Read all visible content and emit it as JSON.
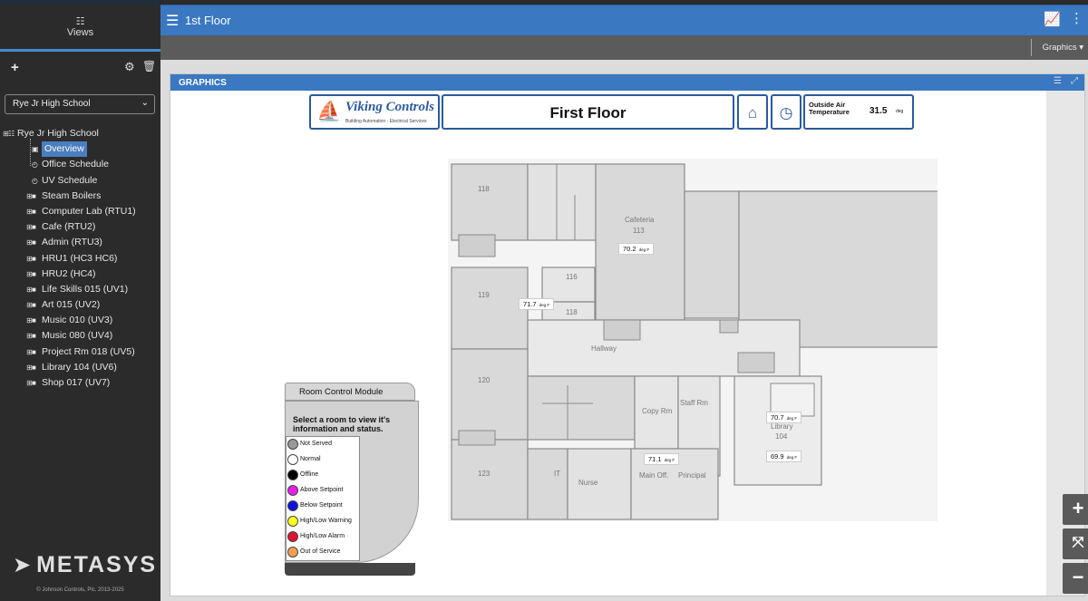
{
  "sidebar": {
    "views_label": "Views",
    "site_select": "Rye Jr High School",
    "tree": [
      {
        "label": "Rye Jr High School",
        "kind": "root"
      },
      {
        "label": "Overview",
        "kind": "child",
        "icon": "graphic-icon",
        "selected": true
      },
      {
        "label": "Office Schedule",
        "kind": "child",
        "icon": "clock-icon"
      },
      {
        "label": "UV Schedule",
        "kind": "child",
        "icon": "clock-icon"
      },
      {
        "label": "Steam Boilers",
        "kind": "folder"
      },
      {
        "label": "Computer Lab (RTU1)",
        "kind": "folder"
      },
      {
        "label": "Cafe (RTU2)",
        "kind": "folder"
      },
      {
        "label": "Admin (RTU3)",
        "kind": "folder"
      },
      {
        "label": "HRU1 (HC3 HC6)",
        "kind": "folder"
      },
      {
        "label": "HRU2 (HC4)",
        "kind": "folder"
      },
      {
        "label": "Life Skills 015 (UV1)",
        "kind": "folder"
      },
      {
        "label": "Art 015 (UV2)",
        "kind": "folder"
      },
      {
        "label": "Music 010 (UV3)",
        "kind": "folder"
      },
      {
        "label": "Music 080 (UV4)",
        "kind": "folder"
      },
      {
        "label": "Project Rm 018 (UV5)",
        "kind": "folder"
      },
      {
        "label": "Library 104 (UV6)",
        "kind": "folder"
      },
      {
        "label": "Shop 017 (UV7)",
        "kind": "folder"
      }
    ],
    "brand": "METASYS",
    "copyright": "© Johnson Controls, Plc. 2013-2025"
  },
  "header": {
    "title": "1st Floor",
    "menu_label": "Graphics ▾"
  },
  "panel": {
    "title": "GRAPHICS"
  },
  "graphic": {
    "logo_name": "Viking Controls",
    "logo_sub": "Building Automation · Electrical Services",
    "floor_title": "First Floor",
    "oat_label_1": "Outside Air",
    "oat_label_2": "Temperature",
    "oat_value": "31.5",
    "oat_unit": "deg"
  },
  "rooms": {
    "r118a": "118",
    "cafeteria": "Cafeteria",
    "cafeteria_num": "113",
    "r116": "116",
    "r119": "119",
    "r118b": "118",
    "hallway": "Hallway",
    "r120": "120",
    "copy": "Copy Rm",
    "staff": "Staff Rm",
    "library": "Library",
    "library_num": "104",
    "r123": "123",
    "it": "IT",
    "nurse": "Nurse",
    "main_off": "Main Off.",
    "principal": "Principal"
  },
  "temps": {
    "cafeteria": "70.2",
    "r119": "71.7",
    "main_off": "71.1",
    "library_a": "70.7",
    "library_b": "69.9",
    "unit": "deg F"
  },
  "rcm": {
    "title": "Room Control Module",
    "heading_1": "Select a room to view it's",
    "heading_2": "information and status.",
    "legend": [
      {
        "label": "Not Served",
        "color": "#9a9a9a"
      },
      {
        "label": "Normal",
        "color": "#ffffff"
      },
      {
        "label": "Offline",
        "color": "#000000"
      },
      {
        "label": "Above Setpoint",
        "color": "#e81ee8"
      },
      {
        "label": "Below Setpoint",
        "color": "#1010e0"
      },
      {
        "label": "High/Low Warning",
        "color": "#ffff20"
      },
      {
        "label": "High/Low Alarm",
        "color": "#e01030"
      },
      {
        "label": "Out of Service",
        "color": "#f5a050"
      }
    ]
  },
  "zoom": {
    "in": "+",
    "fit": "⤧",
    "out": "−"
  }
}
